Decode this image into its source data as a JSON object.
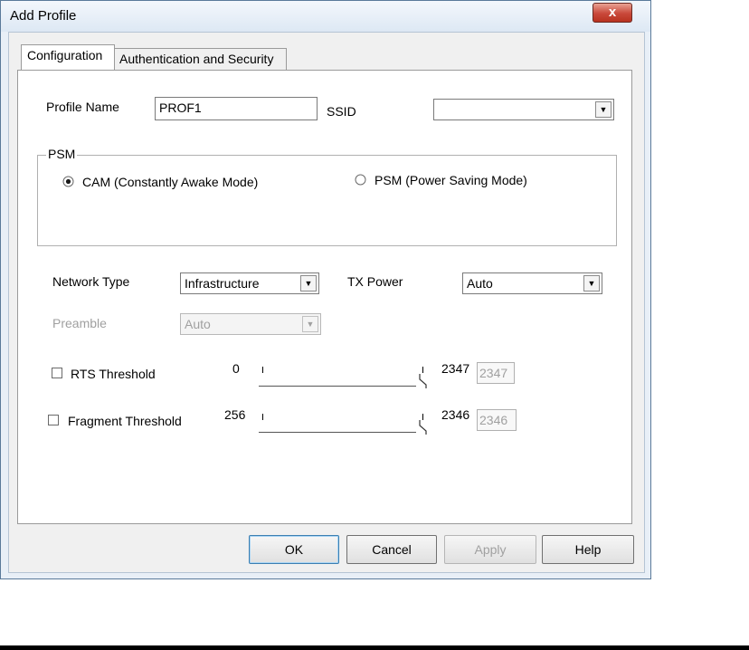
{
  "window": {
    "title": "Add Profile",
    "close_label": "x"
  },
  "tabs": [
    {
      "label": "Configuration",
      "active": true
    },
    {
      "label": "Authentication and Security",
      "active": false
    }
  ],
  "config": {
    "profile_name_label": "Profile Name",
    "profile_name_value": "PROF1",
    "ssid_label": "SSID",
    "ssid_value": "",
    "psm": {
      "group_label": "PSM",
      "cam_label": "CAM (Constantly Awake Mode)",
      "psm_label": "PSM (Power Saving Mode)",
      "selected": "CAM"
    },
    "network_type_label": "Network Type",
    "network_type_value": "Infrastructure",
    "tx_power_label": "TX Power",
    "tx_power_value": "Auto",
    "preamble_label": "Preamble",
    "preamble_value": "Auto",
    "preamble_enabled": false,
    "rts": {
      "label": "RTS Threshold",
      "checked": false,
      "min_label": "0",
      "max_label": "2347",
      "value": "2347"
    },
    "fragment": {
      "label": "Fragment Threshold",
      "checked": false,
      "min_label": "256",
      "max_label": "2346",
      "value": "2346"
    }
  },
  "buttons": {
    "ok": "OK",
    "cancel": "Cancel",
    "apply": "Apply",
    "help": "Help"
  },
  "colors": {
    "window_frame": "#e8eff7",
    "close_button": "#c9483a",
    "disabled_text": "#a0a0a0"
  }
}
